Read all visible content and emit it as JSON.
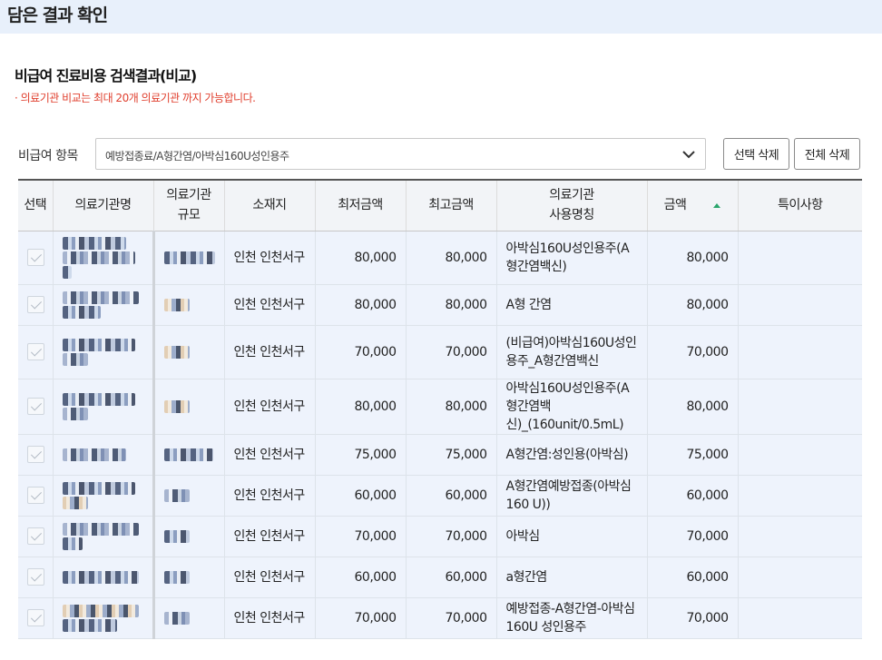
{
  "page": {
    "title": "담은 결과 확인"
  },
  "section": {
    "title": "비급여 진료비용 검색결과(비교)",
    "notice": "· 의료기관 비교는 최대 20개 의료기관 까지 가능합니다."
  },
  "filter": {
    "label": "비급여 항목",
    "value": "예방접종료/A형간염/아박심160U성인용주",
    "chevron_icon": "chevron-down-icon"
  },
  "buttons": {
    "delete_selected": "선택 삭제",
    "delete_all": "전체 삭제"
  },
  "table": {
    "headers": {
      "select": "선택",
      "name": "의료기관명",
      "scale_1": "의료기관",
      "scale_2": "규모",
      "location": "소재지",
      "min": "최저금액",
      "max": "최고금액",
      "usage_1": "의료기관",
      "usage_2": "사용명칭",
      "amount": "금액",
      "note": "특이사항"
    },
    "sort_indicator_color": "#2aa56c",
    "rows": [
      {
        "location": "인천 인천서구",
        "min": "80,000",
        "max": "80,000",
        "usage": "아박심160U성인용주(A형간염백신)",
        "amount": "80,000"
      },
      {
        "location": "인천 인천서구",
        "min": "80,000",
        "max": "80,000",
        "usage": "A형 간염",
        "amount": "80,000"
      },
      {
        "location": "인천 인천서구",
        "min": "70,000",
        "max": "70,000",
        "usage": "(비급여)아박심160U성인용주_A형간염백신",
        "amount": "70,000"
      },
      {
        "location": "인천 인천서구",
        "min": "80,000",
        "max": "80,000",
        "usage": "아박심160U성인용주(A형간염백신)_(160unit/0.5mL)",
        "amount": "80,000"
      },
      {
        "location": "인천 인천서구",
        "min": "75,000",
        "max": "75,000",
        "usage": "A형간염:성인용(아박심)",
        "amount": "75,000"
      },
      {
        "location": "인천 인천서구",
        "min": "60,000",
        "max": "60,000",
        "usage": "A형간염예방접종(아박심 160 U))",
        "amount": "60,000"
      },
      {
        "location": "인천 인천서구",
        "min": "70,000",
        "max": "70,000",
        "usage": "아박심",
        "amount": "70,000"
      },
      {
        "location": "인천 인천서구",
        "min": "60,000",
        "max": "60,000",
        "usage": "a형간염",
        "amount": "60,000"
      },
      {
        "location": "인천 인천서구",
        "min": "70,000",
        "max": "70,000",
        "usage": "예방접종-A형간염-아박심160U 성인용주",
        "amount": "70,000"
      }
    ]
  }
}
